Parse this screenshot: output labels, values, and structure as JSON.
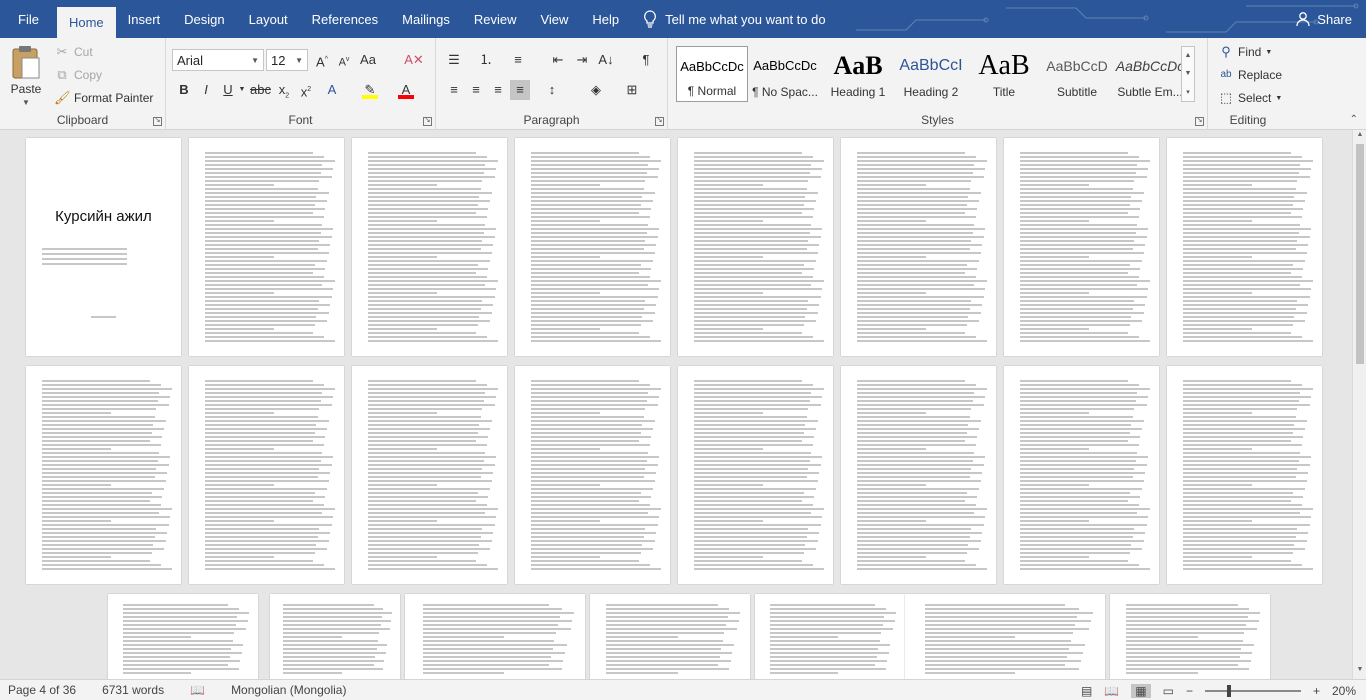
{
  "tabs": [
    {
      "label": "File"
    },
    {
      "label": "Home"
    },
    {
      "label": "Insert"
    },
    {
      "label": "Design"
    },
    {
      "label": "Layout"
    },
    {
      "label": "References"
    },
    {
      "label": "Mailings"
    },
    {
      "label": "Review"
    },
    {
      "label": "View"
    },
    {
      "label": "Help"
    }
  ],
  "tell_me": "Tell me what you want to do",
  "share_label": "Share",
  "clipboard": {
    "group": "Clipboard",
    "paste": "Paste",
    "cut": "Cut",
    "copy": "Copy",
    "format_painter": "Format Painter"
  },
  "font": {
    "group": "Font",
    "family": "Arial",
    "size": "12"
  },
  "paragraph": {
    "group": "Paragraph"
  },
  "styles": {
    "group": "Styles",
    "items": [
      {
        "sample": "AaBbCcDc",
        "name": "¶ Normal"
      },
      {
        "sample": "AaBbCcDc",
        "name": "¶ No Spac..."
      },
      {
        "sample": "AaB",
        "name": "Heading 1"
      },
      {
        "sample": "AaBbCcI",
        "name": "Heading 2"
      },
      {
        "sample": "AaB",
        "name": "Title"
      },
      {
        "sample": "AaBbCcD",
        "name": "Subtitle"
      },
      {
        "sample": "AaBbCcDc",
        "name": "Subtle Em..."
      }
    ]
  },
  "editing": {
    "group": "Editing",
    "find": "Find",
    "replace": "Replace",
    "select": "Select"
  },
  "cover_page": {
    "title": "Курсийн ажил"
  },
  "status": {
    "page": "Page 4 of 36",
    "words": "6731 words",
    "language": "Mongolian (Mongolia)",
    "zoom": "20%"
  },
  "colors": {
    "accent": "#2b579a",
    "highlight": "#ffff00",
    "font_color": "#ff0000"
  }
}
